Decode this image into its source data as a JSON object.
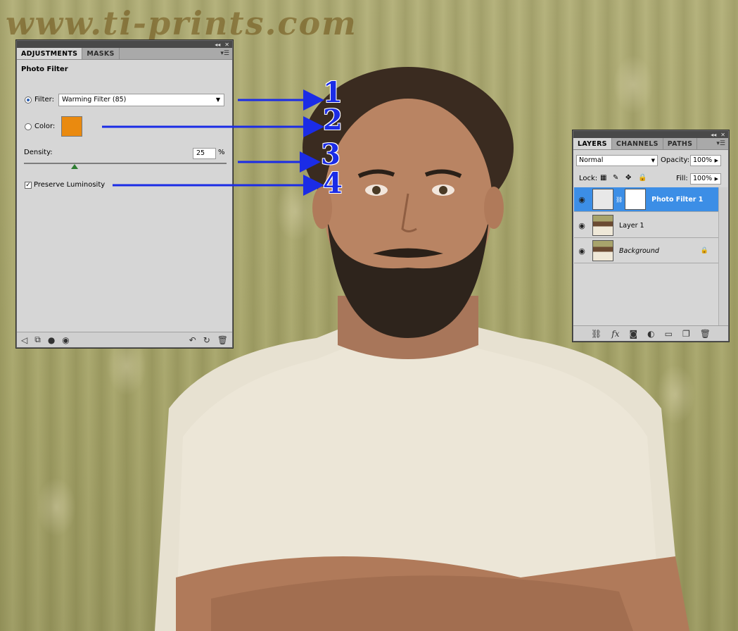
{
  "watermark": "www.ti-prints.com",
  "adjustments_panel": {
    "tabs": [
      "ADJUSTMENTS",
      "MASKS"
    ],
    "title": "Photo Filter",
    "filter_label": "Filter:",
    "filter_value": "Warming Filter (85)",
    "color_label": "Color:",
    "color_value": "#ea8a0f",
    "density_label": "Density:",
    "density_value": "25",
    "density_unit": "%",
    "density_fraction": 0.25,
    "preserve_luminosity_label": "Preserve Luminosity",
    "preserve_luminosity_checked": true
  },
  "layers_panel": {
    "tabs": [
      "LAYERS",
      "CHANNELS",
      "PATHS"
    ],
    "blend_mode": "Normal",
    "opacity_label": "Opacity:",
    "opacity_value": "100%",
    "lock_label": "Lock:",
    "fill_label": "Fill:",
    "fill_value": "100%",
    "layers": [
      {
        "name": "Photo Filter 1",
        "selected": true
      },
      {
        "name": "Layer 1",
        "selected": false
      },
      {
        "name": "Background",
        "selected": false,
        "locked": true
      }
    ]
  },
  "annotations": [
    "1",
    "2",
    "3",
    "4"
  ],
  "colors": {
    "arrow": "#1b2ce6",
    "selection": "#3c8ee6",
    "swatch": "#ea8a0f"
  }
}
